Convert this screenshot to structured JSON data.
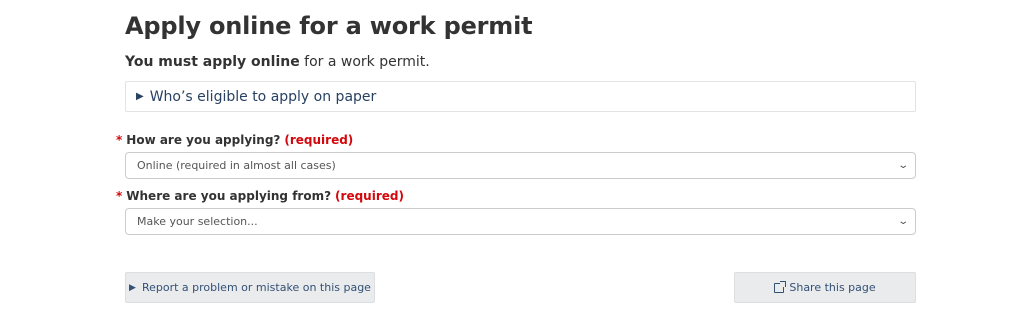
{
  "page": {
    "title": "Apply online for a work permit",
    "lead_strong": "You must apply online",
    "lead_rest": " for a work permit."
  },
  "details": {
    "summary": "Who’s eligible to apply on paper"
  },
  "form": {
    "required_marker": "*",
    "q1": {
      "label": "How are you applying?",
      "required_text": "(required)",
      "selected": "Online (required in almost all cases)"
    },
    "q2": {
      "label": "Where are you applying from?",
      "required_text": "(required)",
      "selected": "Make your selection..."
    }
  },
  "footer": {
    "report_label": "Report a problem or mistake on this page",
    "share_label": "Share this page"
  },
  "colors": {
    "link": "#284162",
    "required": "#d3080c",
    "button_bg": "#eaebed"
  },
  "icons": {
    "details": "triangle-right",
    "select": "chevron-down",
    "report": "triangle-right",
    "share": "external-share"
  }
}
